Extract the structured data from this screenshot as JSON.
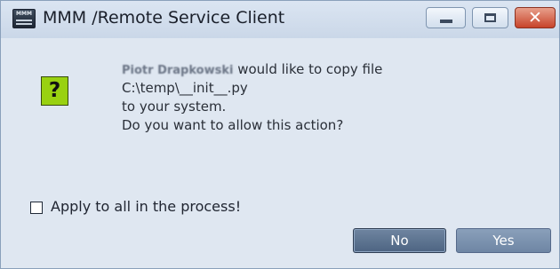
{
  "window": {
    "title": "MMM /Remote Service Client",
    "app_icon_text": "MMM"
  },
  "controls": {
    "minimize_icon": "minimize-icon",
    "maximize_icon": "maximize-icon",
    "close_icon": "close-icon",
    "close_glyph": "✕"
  },
  "dialog": {
    "icon_glyph": "?",
    "requester_name": "Piotr Drapkowski",
    "line1_suffix": " would like to copy file",
    "file_path": "C:\\temp\\__init__.py",
    "line3": "to your system.",
    "line4": "Do you want to allow this action?",
    "apply_all_label": "Apply to all in the process!",
    "apply_all_checked": false
  },
  "buttons": {
    "no_label": "No",
    "yes_label": "Yes"
  },
  "colors": {
    "window_bg": "#dfe7f1",
    "question_icon_bg": "#99d111",
    "close_button": "#c7432a",
    "primary_button": "#4d6482"
  }
}
